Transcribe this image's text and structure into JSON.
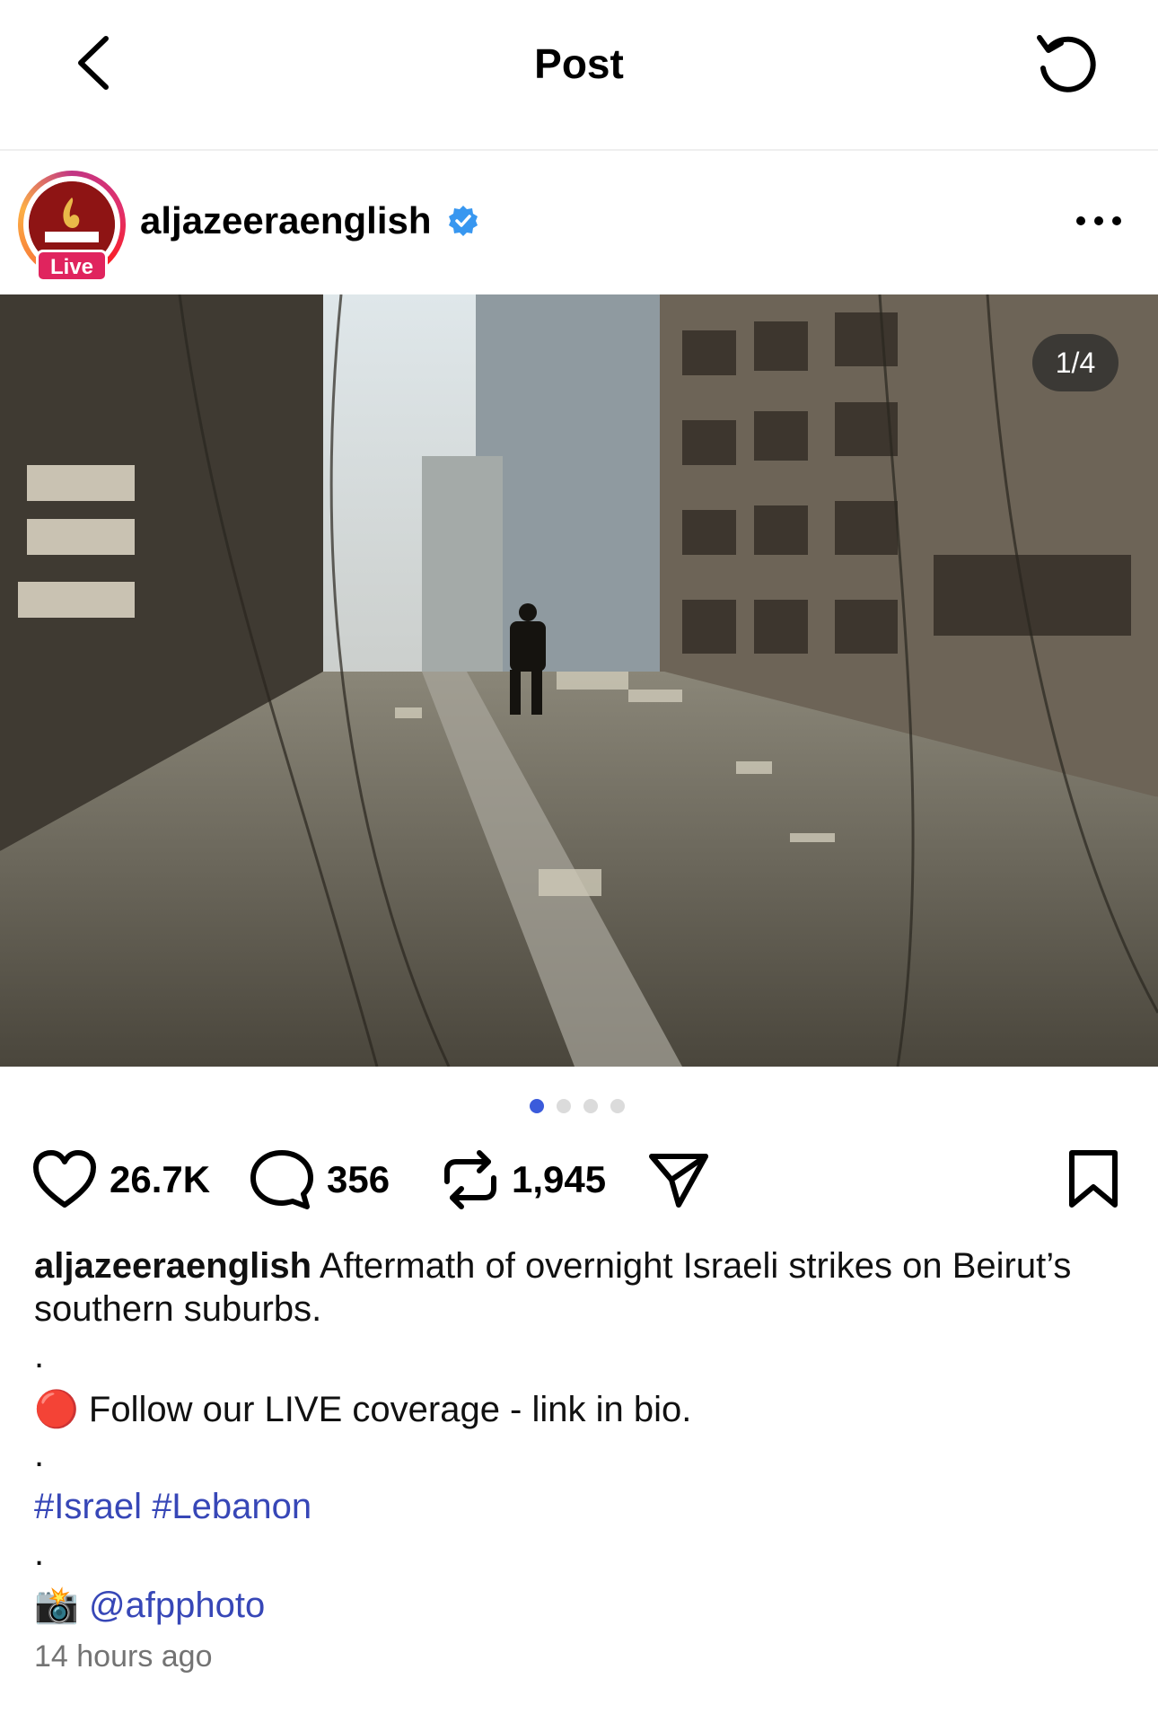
{
  "header": {
    "title": "Post"
  },
  "post": {
    "username": "aljazeeraenglish",
    "avatar_text": "ALJAZEERA",
    "live_label": "Live",
    "image_counter": "1/4",
    "carousel": {
      "count": 4,
      "active_index": 0
    },
    "likes": "26.7K",
    "comments": "356",
    "reposts": "1,945",
    "caption": {
      "user": "aljazeeraenglish",
      "text": " Aftermath of overnight Israeli strikes on Beirut’s southern suburbs.",
      "sep1": ".",
      "live_emoji": "🔴",
      "live_text": " Follow our LIVE coverage - link in bio.",
      "sep2": ".",
      "hashtags": [
        "#Israel",
        "#Lebanon"
      ],
      "sep3": ".",
      "camera_emoji": "📸",
      "photo_credit": "@afpphoto"
    },
    "timestamp": "14 hours ago"
  },
  "colors": {
    "link": "#3747b7",
    "live_badge": "#e0245e",
    "verified": "#3897f0",
    "dot_active": "#3b5bdb"
  }
}
